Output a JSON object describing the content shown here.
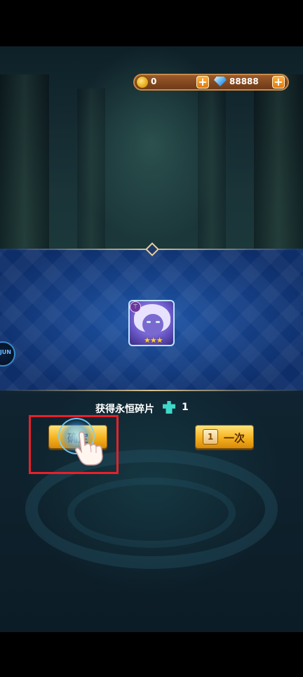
{
  "currency": {
    "gold": "0",
    "gems": "88888",
    "gold_icon": "gold-coin-icon",
    "gem_icon": "diamond-icon",
    "plus_symbol": "+"
  },
  "reward": {
    "hero_stars": "★★★",
    "hero_class_symbol": "⚚",
    "hero_card_border_color": "#bfe4ff"
  },
  "side_widget": {
    "label": "JUN"
  },
  "obtain": {
    "text": "获得永恒碎片",
    "count": "1",
    "icon": "puzzle-piece-icon"
  },
  "buttons": {
    "confirm_label": "确定",
    "again_label": "一次",
    "again_icon": "scroll-icon",
    "again_icon_glyph": "1"
  },
  "colors": {
    "accent_gold": "#f5b21e",
    "highlight_red": "#e8202a",
    "band_blue": "#1f56a8"
  }
}
